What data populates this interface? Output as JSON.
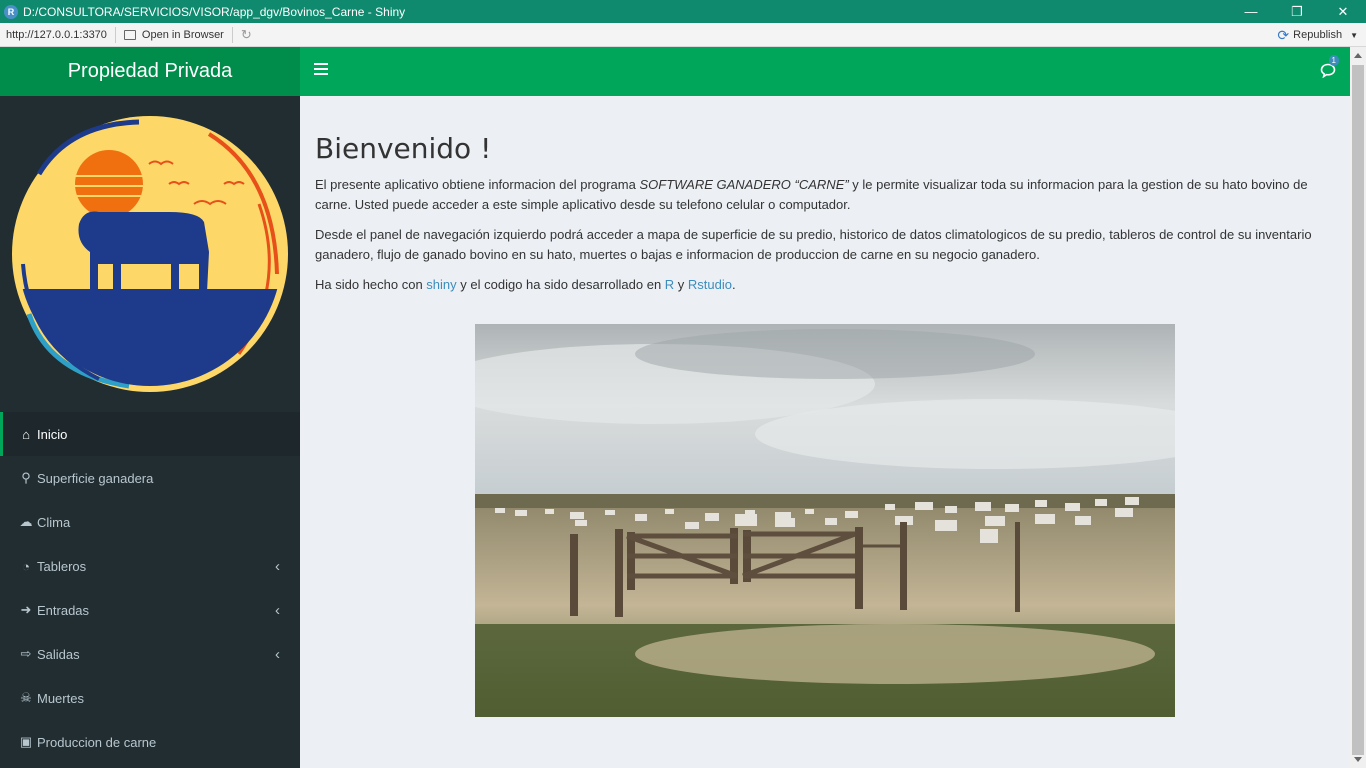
{
  "window": {
    "title": "D:/CONSULTORA/SERVICIOS/VISOR/app_dgv/Bovinos_Carne - Shiny",
    "app_icon": "R",
    "controls": [
      "minimize-icon",
      "restore-icon",
      "close-icon"
    ]
  },
  "toolbar": {
    "url": "http://127.0.0.1:3370",
    "open_in_browser": "Open in Browser",
    "republish": "Republish"
  },
  "sidebar": {
    "brand": "Propiedad Privada",
    "items": [
      {
        "label": "Inicio",
        "icon": "home-icon",
        "active": true
      },
      {
        "label": "Superficie ganadera",
        "icon": "map-marker-icon"
      },
      {
        "label": "Clima",
        "icon": "cloud-sun-icon"
      },
      {
        "label": "Tableros",
        "icon": "dashboard-icon",
        "has_submenu": true
      },
      {
        "label": "Entradas",
        "icon": "sign-in-icon",
        "has_submenu": true
      },
      {
        "label": "Salidas",
        "icon": "sign-out-icon",
        "has_submenu": true
      },
      {
        "label": "Muertes",
        "icon": "skull-crossbones-icon"
      },
      {
        "label": "Produccion de carne",
        "icon": "industry-icon"
      }
    ]
  },
  "header": {
    "notification_count": "1"
  },
  "main": {
    "title": "Bienvenido !",
    "p1_pre": "El presente aplicativo obtiene informacion del programa ",
    "p1_em": "SOFTWARE GANADERO “CARNE”",
    "p1_post": " y le permite visualizar toda su informacion para la gestion de su hato bovino de carne. Usted puede acceder a este simple aplicativo desde su telefono celular o computador.",
    "p2": "Desde el panel de navegación izquierdo podrá acceder a mapa de superficie de su predio, historico de datos climatologicos de su predio, tableros de control de su inventario ganadero, flujo de ganado bovino en su hato, muertes o bajas e informacion de produccion de carne en su negocio ganadero.",
    "p3_pre": "Ha sido hecho con ",
    "link_shiny": "shiny",
    "p3_mid": " y el codigo ha sido desarrollado en ",
    "link_r": "R",
    "p3_y": " y ",
    "link_rstudio": "Rstudio",
    "p3_end": "."
  },
  "colors": {
    "header": "#00a65a",
    "brand": "#008d4c",
    "sidebar": "#222d32",
    "content_bg": "#ecf0f5",
    "link": "#3c8dbc"
  }
}
